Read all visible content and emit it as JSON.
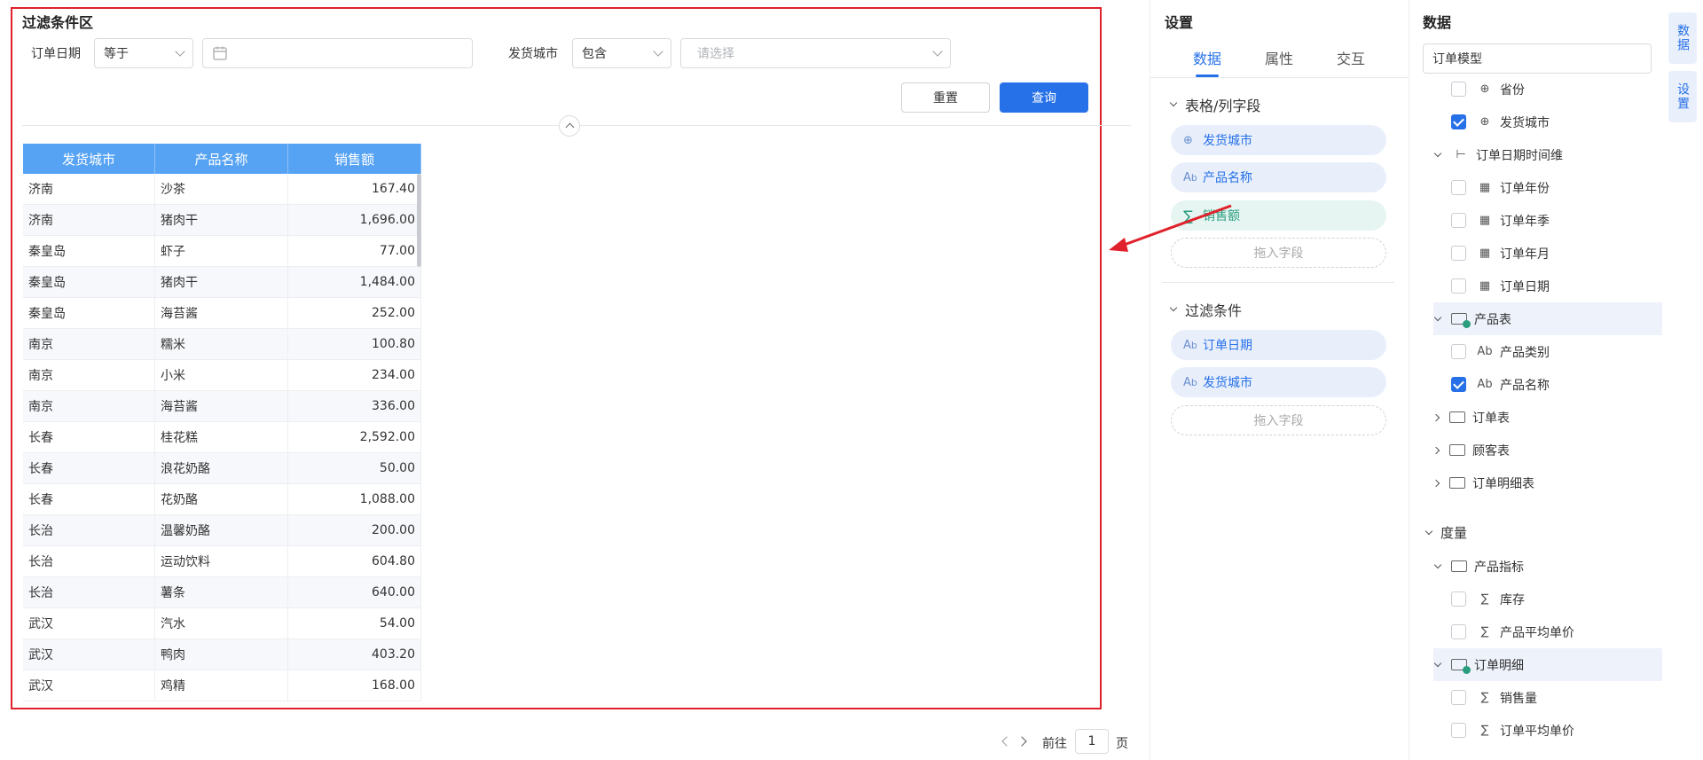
{
  "filter_panel": {
    "title": "过滤条件区",
    "order_date": {
      "label": "订单日期",
      "operator": "等于",
      "date_value": ""
    },
    "ship_city": {
      "label": "发货城市",
      "operator": "包含",
      "placeholder": "请选择"
    },
    "reset_label": "重置",
    "query_label": "查询"
  },
  "table": {
    "columns": [
      "发货城市",
      "产品名称",
      "销售额"
    ],
    "rows": [
      [
        "济南",
        "沙茶",
        "167.40"
      ],
      [
        "济南",
        "猪肉干",
        "1,696.00"
      ],
      [
        "秦皇岛",
        "虾子",
        "77.00"
      ],
      [
        "秦皇岛",
        "猪肉干",
        "1,484.00"
      ],
      [
        "秦皇岛",
        "海苔酱",
        "252.00"
      ],
      [
        "南京",
        "糯米",
        "100.80"
      ],
      [
        "南京",
        "小米",
        "234.00"
      ],
      [
        "南京",
        "海苔酱",
        "336.00"
      ],
      [
        "长春",
        "桂花糕",
        "2,592.00"
      ],
      [
        "长春",
        "浪花奶酪",
        "50.00"
      ],
      [
        "长春",
        "花奶酪",
        "1,088.00"
      ],
      [
        "长治",
        "温馨奶酪",
        "200.00"
      ],
      [
        "长治",
        "运动饮料",
        "604.80"
      ],
      [
        "长治",
        "薯条",
        "640.00"
      ],
      [
        "武汉",
        "汽水",
        "54.00"
      ],
      [
        "武汉",
        "鸭肉",
        "403.20"
      ],
      [
        "武汉",
        "鸡精",
        "168.00"
      ]
    ]
  },
  "pagination": {
    "goto_label": "前往",
    "page": "1",
    "page_suffix": "页"
  },
  "settings": {
    "title": "设置",
    "tabs": [
      "数据",
      "属性",
      "交互"
    ],
    "active_tab": "数据",
    "section_fields": {
      "title": "表格/列字段",
      "items": [
        {
          "label": "发货城市",
          "icon": "globe-icon"
        },
        {
          "label": "产品名称",
          "icon": "text-field-icon"
        },
        {
          "label": "销售额",
          "icon": "sigma-icon"
        }
      ],
      "drop_label": "拖入字段"
    },
    "section_filters": {
      "title": "过滤条件",
      "items": [
        {
          "label": "订单日期",
          "icon": "text-field-icon"
        },
        {
          "label": "发货城市",
          "icon": "text-field-icon"
        }
      ],
      "drop_label": "拖入字段"
    }
  },
  "data_panel": {
    "title": "数据",
    "model": "订单模型",
    "tree": [
      {
        "label": "省份",
        "type": "field",
        "icon": "globe-icon",
        "checked": false,
        "indent": 1
      },
      {
        "label": "发货城市",
        "type": "field",
        "icon": "globe-icon",
        "checked": true,
        "indent": 1
      },
      {
        "label": "订单日期时间维",
        "type": "group",
        "icon": "hierarchy-icon",
        "expanded": true,
        "indent": 0
      },
      {
        "label": "订单年份",
        "type": "field",
        "icon": "date-icon",
        "checked": false,
        "indent": 1
      },
      {
        "label": "订单年季",
        "type": "field",
        "icon": "date-icon",
        "checked": false,
        "indent": 1
      },
      {
        "label": "订单年月",
        "type": "field",
        "icon": "date-icon",
        "checked": false,
        "indent": 1
      },
      {
        "label": "订单日期",
        "type": "field",
        "icon": "date-icon",
        "checked": false,
        "indent": 1
      },
      {
        "label": "产品表",
        "type": "folder",
        "icon": "folder-check-icon",
        "expanded": true,
        "highlight": true,
        "indent": 0
      },
      {
        "label": "产品类别",
        "type": "field",
        "icon": "text-field-icon",
        "checked": false,
        "indent": 1
      },
      {
        "label": "产品名称",
        "type": "field",
        "icon": "text-field-icon",
        "checked": true,
        "indent": 1
      },
      {
        "label": "订单表",
        "type": "folder",
        "icon": "folder-icon",
        "expanded": false,
        "indent": 0
      },
      {
        "label": "顾客表",
        "type": "folder",
        "icon": "folder-icon",
        "expanded": false,
        "indent": 0
      },
      {
        "label": "订单明细表",
        "type": "folder",
        "icon": "folder-icon",
        "expanded": false,
        "indent": 0
      }
    ],
    "measures_title": "度量",
    "measures": [
      {
        "label": "产品指标",
        "type": "folder",
        "icon": "folder-open-icon",
        "expanded": true,
        "indent": 0
      },
      {
        "label": "库存",
        "type": "field",
        "icon": "sigma-icon",
        "checked": false,
        "indent": 1
      },
      {
        "label": "产品平均单价",
        "type": "field",
        "icon": "sigma-icon",
        "checked": false,
        "indent": 1
      },
      {
        "label": "订单明细",
        "type": "folder",
        "icon": "folder-check-icon",
        "expanded": true,
        "highlight": true,
        "indent": 0
      },
      {
        "label": "销售量",
        "type": "field",
        "icon": "sigma-icon",
        "checked": false,
        "indent": 1
      },
      {
        "label": "订单平均单价",
        "type": "field",
        "icon": "sigma-icon",
        "checked": false,
        "indent": 1
      }
    ]
  },
  "side_tabs": [
    "数据",
    "设置"
  ],
  "colors": {
    "accent": "#2670e8",
    "header": "#57a3f3",
    "frame": "#e0202a",
    "green": "#2a9d7f"
  }
}
